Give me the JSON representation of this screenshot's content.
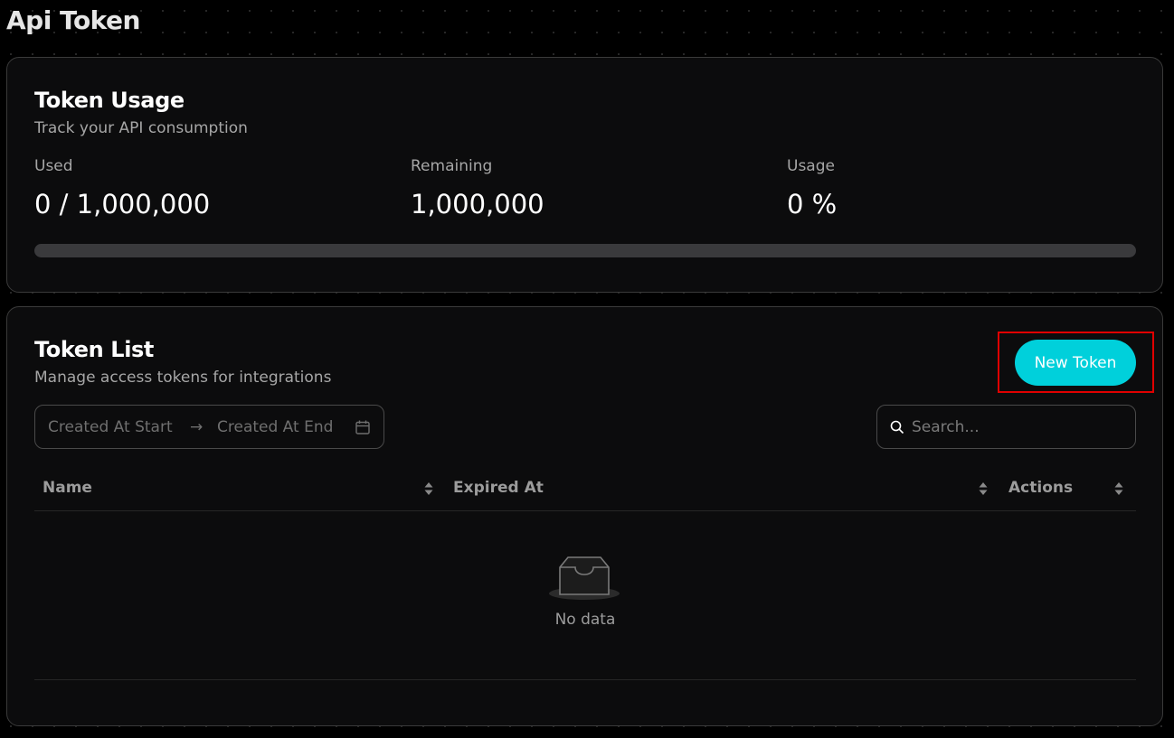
{
  "page": {
    "title": "Api Token"
  },
  "usage": {
    "title": "Token Usage",
    "subtitle": "Track your API consumption",
    "used_label": "Used",
    "used_value": "0 / 1,000,000",
    "remaining_label": "Remaining",
    "remaining_value": "1,000,000",
    "usage_label": "Usage",
    "usage_value": "0 %",
    "progress_fraction": 0
  },
  "token_list": {
    "title": "Token List",
    "subtitle": "Manage access tokens for integrations",
    "new_button": "New Token",
    "date_start_placeholder": "Created At Start",
    "date_arrow": "→",
    "date_end_placeholder": "Created At End",
    "search_placeholder": "Search...",
    "columns": [
      "Name",
      "Expired At",
      "Actions"
    ],
    "empty_text": "No data"
  },
  "colors": {
    "accent": "#00d0db",
    "highlight": "#e00000"
  },
  "icons": [
    "calendar-icon",
    "search-icon",
    "sort-icon",
    "empty-inbox-icon"
  ]
}
